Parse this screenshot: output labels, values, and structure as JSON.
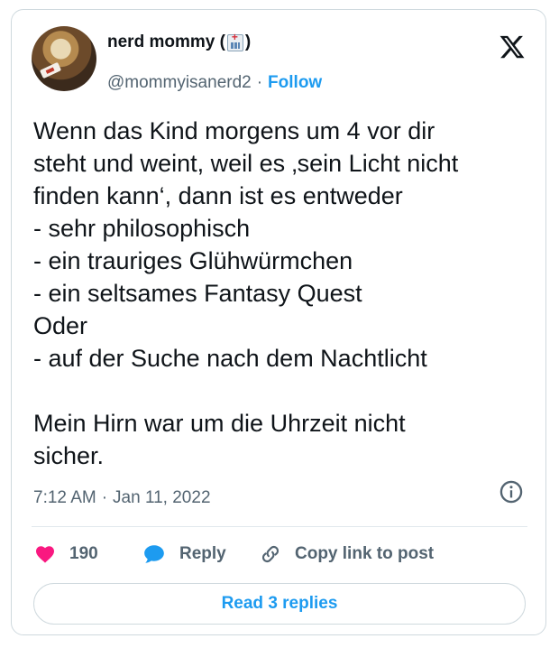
{
  "author": {
    "display_name": "nerd mommy (",
    "display_name_suffix": ")",
    "name_emoji": "hospital-emoji",
    "handle": "@mommyisanerd2",
    "separator": "·",
    "follow_label": "Follow"
  },
  "tweet": {
    "text": "Wenn das Kind morgens um 4 vor dir\nsteht und weint, weil es ‚sein Licht nicht\nfinden kann‘, dann ist es entweder\n- sehr philosophisch\n- ein trauriges Glühwürmchen\n- ein seltsames Fantasy Quest\nOder\n- auf der Suche nach dem Nachtlicht\n\nMein Hirn war um die Uhrzeit nicht\nsicher.",
    "time": "7:12 AM",
    "separator": "·",
    "date": "Jan 11, 2022"
  },
  "actions": {
    "like_count": "190",
    "reply_label": "Reply",
    "copy_link_label": "Copy link to post"
  },
  "replies_button": "Read 3 replies",
  "icons": {
    "like": "heart-icon",
    "reply": "speech-bubble-icon",
    "copy_link": "link-icon",
    "info": "info-icon",
    "brand": "x-logo-icon"
  },
  "colors": {
    "accent": "#1d9bf0",
    "like": "#f91880",
    "text": "#0f1419",
    "muted": "#536471"
  }
}
